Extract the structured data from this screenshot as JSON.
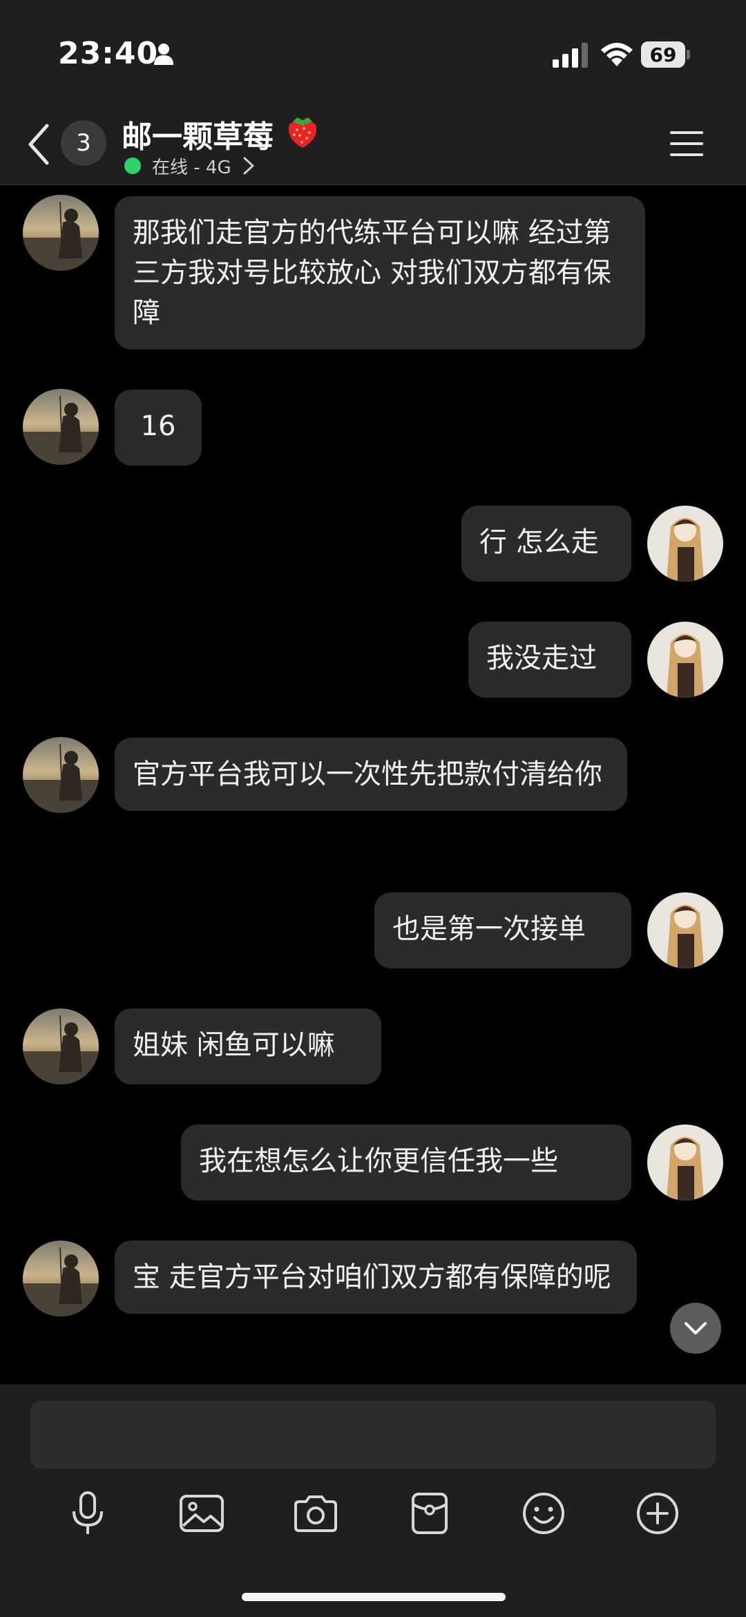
{
  "status_bar": {
    "time": "23:40",
    "battery": "69"
  },
  "header": {
    "unread_count": "3",
    "chat_name": "邮一颗草莓",
    "name_emoji": "strawberry-icon",
    "presence": "在线 - 4G"
  },
  "messages": [
    {
      "side": "left",
      "text": "那我们走官方的代练平台可以嘛  经过第三方我对号比较放心 对我们双方都有保障"
    },
    {
      "side": "left",
      "text": "16"
    },
    {
      "side": "right",
      "text": "行 怎么走"
    },
    {
      "side": "right",
      "text": "我没走过"
    },
    {
      "side": "left",
      "text": "官方平台我可以一次性先把款付清给你"
    },
    {
      "side": "right",
      "text": "也是第一次接单"
    },
    {
      "side": "left",
      "text": "姐妹 闲鱼可以嘛"
    },
    {
      "side": "right",
      "text": "我在想怎么让你更信任我一些"
    },
    {
      "side": "left",
      "text": "宝 走官方平台对咱们双方都有保障的呢"
    }
  ],
  "input": {
    "placeholder": ""
  },
  "toolbar": [
    "mic-icon",
    "image-icon",
    "camera-icon",
    "red-packet-icon",
    "emoji-icon",
    "plus-icon"
  ],
  "colors": {
    "background": "#000000",
    "bar": "#1f1f1f",
    "bubble": "#2b2b2b",
    "online": "#2fd36b"
  }
}
